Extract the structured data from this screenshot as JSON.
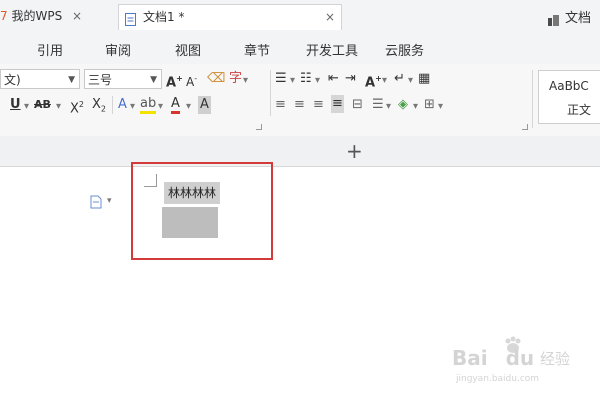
{
  "window": {
    "title_fragment": "文档"
  },
  "menu": {
    "tabs": [
      {
        "label": "引用"
      },
      {
        "label": "审阅"
      },
      {
        "label": "视图"
      },
      {
        "label": "章节"
      },
      {
        "label": "开发工具"
      },
      {
        "label": "云服务"
      }
    ]
  },
  "ribbon": {
    "font_name": "文)",
    "font_size": "三号",
    "grow_font": "A",
    "shrink_font": "A",
    "underline": "U",
    "strikethrough": "AB",
    "superscript": "X",
    "subscript": "X",
    "text_effect": "A",
    "font_color": "A",
    "char_shading": "A",
    "style_preview": "AaBbC",
    "style_name": "正文",
    "text_direction": "A"
  },
  "colors": {
    "highlight_box": "#d43a3a",
    "font_color_bar": "#d9342b",
    "highlighter_bar": "#f3e100",
    "wps_orange": "#e35a2a"
  },
  "doc_tabs": {
    "home_prefix": "7",
    "home_label": "我的WPS",
    "active_label": "文档1 *",
    "close_glyph": "×",
    "new_tab_glyph": "+"
  },
  "document": {
    "selected_text": "林林林林"
  },
  "watermark": {
    "brand": "Bai",
    "brand2": "du",
    "suffix": "经验",
    "url": "jingyan.baidu.com"
  }
}
